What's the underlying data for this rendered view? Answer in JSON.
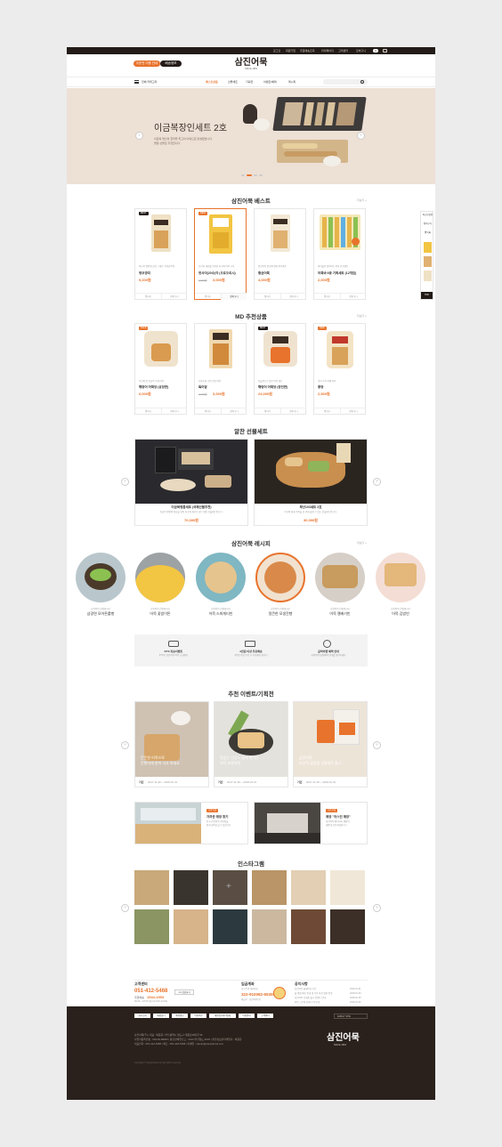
{
  "topbar": {
    "links": [
      "로그인",
      "회원가입",
      "주문배송조회",
      "마이페이지",
      "고객센터",
      "장바구니"
    ],
    "cart_count": "0"
  },
  "header": {
    "pill_left": "주문전 이용 안내",
    "pill_right": "배송정보",
    "logo": "삼진어묵",
    "logo_sub": "SINCE 1953"
  },
  "nav": {
    "all_category": "전체 카테고리",
    "items": [
      "베스트상품",
      "선물세트",
      "기획전",
      "이벤트/혜택",
      "레시피"
    ],
    "search_placeholder": ""
  },
  "hero": {
    "title": "이금복장인세트 2호",
    "desc1": "이금복 명인의 철학을 최고의 어묵으로 탄생했습니다.",
    "desc2": "명절 선물로 추천합니다."
  },
  "best": {
    "title": "삼진어묵 베스트",
    "more": "더보기 +",
    "products": [
      {
        "badge": "BEST",
        "desc": "이금복 명인의 손맛 그대로 구워낸 어묵",
        "name": "명보깡띠",
        "old": "",
        "price": "9,200원",
        "btn1": "찜하기",
        "btn2": "장바구니"
      },
      {
        "badge": "NEW",
        "desc": "신선한 재료를 사용한 최고의 어묵 시식",
        "name": "핫사이(20수)각 (오로오리시)",
        "old": "4,000원",
        "price": "3,000원",
        "btn1": "찜하기",
        "btn2": "장바구니"
      },
      {
        "badge": "",
        "desc": "삼진어묵 원조의 명품 어묵세트",
        "name": "황금어묵",
        "old": "",
        "price": "4,000원",
        "btn1": "찜하기",
        "btn2": "장바구니"
      },
      {
        "badge": "",
        "desc": "아이들이 좋아하는 어묵 간식세트",
        "name": "어묵바 6종 기획세트 (12개입)",
        "old": "",
        "price": "2,000원",
        "btn1": "찜하기",
        "btn2": "장바구니"
      }
    ]
  },
  "side_widget": {
    "labels": [
      "최근본상품",
      "장바구니",
      "찜목록"
    ],
    "top": "TOP"
  },
  "md": {
    "title": "MD 추천상품",
    "more": "더보기 +",
    "products": [
      {
        "badge": "SALE",
        "desc": "부산의 맛 이금복 수제 어묵",
        "name": "해랑어 어묵당 (공장판)",
        "old": "",
        "price": "6,000원",
        "btn1": "찜하기",
        "btn2": "장바구니"
      },
      {
        "badge": "",
        "desc": "두툼하게 구운 한입 어묵",
        "name": "특어말",
        "old": "4,000원",
        "price": "3,000원",
        "btn1": "찜하기",
        "btn2": "장바구니"
      },
      {
        "badge": "BEST",
        "desc": "선물용으로 좋은 어묵 세트",
        "name": "해랑어 어묵당 (장인판)",
        "old": "",
        "price": "24,000원",
        "btn1": "찜하기",
        "btn2": "장바구니"
      },
      {
        "badge": "NEW",
        "desc": "풍미 가득 야채 어묵",
        "name": "풍양",
        "old": "",
        "price": "2,500원",
        "btn1": "찜하기",
        "btn2": "장바구니"
      }
    ]
  },
  "gift": {
    "title": "알찬 선물세트",
    "items": [
      {
        "name": "이금복명품세트 (국제선물추천)",
        "desc": "이금복 명인의 정성을 담아 최고의 재료로 만든 명품 선물세트입니다.",
        "price": "70,000원"
      },
      {
        "name": "부산103세트 2호",
        "desc": "부산의 대표 어묵을 한 번에 즐길 수 있는 선물세트입니다.",
        "price": "30,000원"
      }
    ]
  },
  "recipe": {
    "title": "삼진어묵 레시피",
    "more": "더보기 +",
    "items": [
      {
        "sub": "삼진어묵 간편레시피",
        "name": "삼경면 모어튼롤빵"
      },
      {
        "sub": "삼진어묵 간편레시피",
        "name": "어묵 꽃밤이튼"
      },
      {
        "sub": "삼진어묵 간편레시피",
        "name": "어묵 스파게티빈"
      },
      {
        "sub": "삼진어묵 간편레시피",
        "name": "얼큰한 모생잔빵"
      },
      {
        "sub": "삼진어묵 간편레시피",
        "name": "어묵 캘배기빈"
      },
      {
        "sub": "삼진어묵 간편레시피",
        "name": "어묵 김밥빈"
      }
    ]
  },
  "services": [
    {
      "title": "KTX 특송이벤트",
      "desc": "KTX로 삼진어묵 어묵 고급배송"
    },
    {
      "title": "3만원 이상 무료배송",
      "desc": "3만원 이상 주문 시 무료배송 됩니다"
    },
    {
      "title": "굽벅이벤 혜택 안내",
      "desc": "굽벅이벤 회원혜택 안내를 확인하세요"
    }
  ],
  "events": {
    "title": "추천 이벤트/기획전",
    "items": [
      {
        "caption1": "든든한 어묵으로",
        "caption2": "간편하게 한끼 식사 하세요",
        "label": "기간",
        "date": "2017.11.30 ~ 2018.01.31"
      },
      {
        "caption1": "맛있는 건강도 함께 챙기는",
        "caption2": "어묵 보양어묵",
        "label": "기간",
        "date": "2017.11.30 ~ 2018.01.31"
      },
      {
        "caption1": "삼진어묵",
        "caption2": "부산역 광장점 선물세트 출시",
        "label": "기간",
        "date": "2017.11.30 ~ 2018.01.31"
      }
    ]
  },
  "promos": [
    {
      "badge": "오픈기념",
      "title": "가까운 매장 찾기",
      "desc1": "전국 삼진어묵 직영점을",
      "desc2": "쉽게 찾아보실 수 있습니다"
    },
    {
      "badge": "오픈기념",
      "title": "매장 \"어스인 매장\"",
      "desc1": "삼진어묵 베이커리 매장이",
      "desc2": "새롭게 오픈하였습니다"
    }
  ],
  "instagram": {
    "title": "인스타그램"
  },
  "info": {
    "cs_title": "고객센터",
    "cs_phone": "051-412-5468",
    "cs_label2": "주문배송",
    "cs_phone2": "1544-1953",
    "cs_hours": "09:00 ~ 18:00 (점심 12:00~13:00)",
    "cs_bank": "NH농협은행 301-0182-1953-71",
    "cs_bank2": "예금주 : 삼진어묵(주)",
    "cs_btn1": "1:1 상담하기",
    "cs_btn2": "FAQ 바로가기",
    "kakao": "카카오톡",
    "biz_title": "입금계좌",
    "biz_desc1": "부산은행 계좌번호",
    "biz_phone": "322-910082-65305",
    "biz_desc2": "예금주 : 삼진어묵(주)",
    "biz_btn": "입금계좌 확인하기",
    "notice_title": "공지사항",
    "notices": [
      {
        "text": "삼진어묵 홈페이지 오픈",
        "date": "2018.01.31"
      },
      {
        "text": "설 명절 배송 안내 및 주문 마감 일정 안내",
        "date": "2018.01.30"
      },
      {
        "text": "삼진어묵 신제품 출시 이벤트 안내",
        "date": "2018.01.25"
      },
      {
        "text": "어묵 고로케 판매 시작 안내",
        "date": "2018.01.20"
      },
      {
        "text": "개인정보 처리방침 변경 안내",
        "date": "2018.01.15"
      }
    ]
  },
  "footer": {
    "links": [
      "회사소개",
      "매장찾기",
      "채용정보",
      "이용약관",
      "개인정보처리방침",
      "이용안내",
      "고객센터"
    ],
    "family_site": "FAMILY SITE",
    "address": "삼진어묵(주) | 대표 : 박용준 | 부산광역시 영도구 태종로99번길 36",
    "biz": "사업자등록번호 : 603-81-88000 | 통신판매업신고 : 2013-부산영도-0078 | 개인정보관리책임자 : 박용준",
    "contact": "대표전화 : 051-412-5468 | 팩스 : 051-418-5468 | 이메일 : samjin@samjinfood.com",
    "copyright": "Copyright © samjinfood.com All rights reserved.",
    "logo": "삼진어묵",
    "logo_sub": "SINCE 1953"
  },
  "colors": {
    "accent": "#e8732c",
    "dark": "#231b17",
    "hero_bg": "#ede0d5"
  }
}
